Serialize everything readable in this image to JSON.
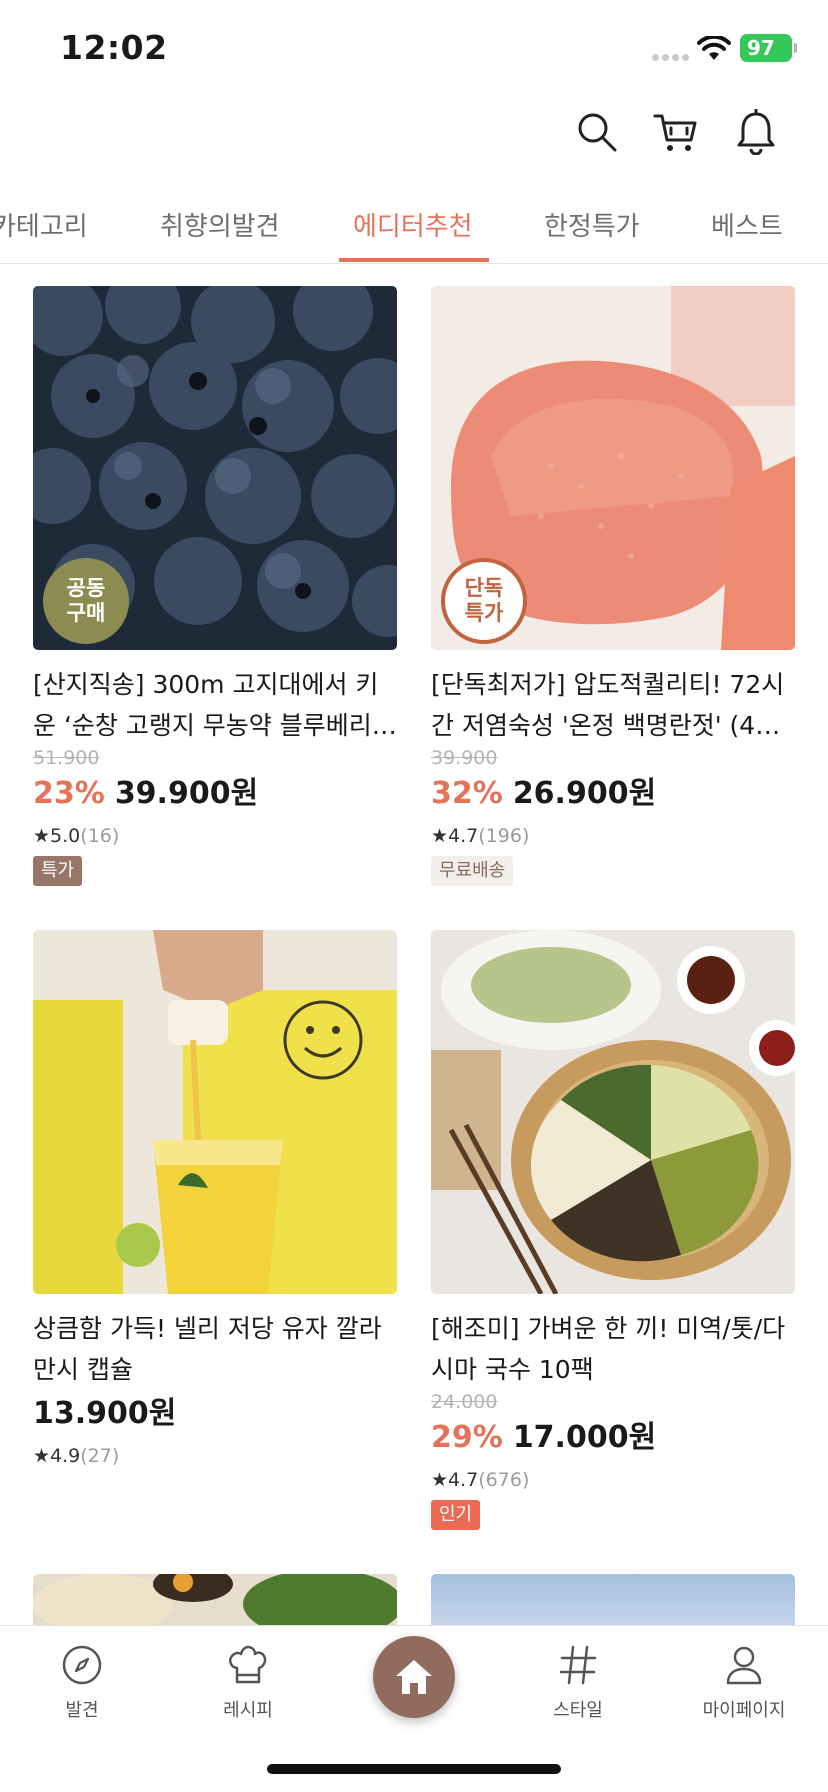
{
  "status_bar": {
    "time": "12:02",
    "battery": "97"
  },
  "header": {
    "icons": [
      "search-icon",
      "cart-icon",
      "bell-icon"
    ]
  },
  "tabs": [
    {
      "label": "카테고리"
    },
    {
      "label": "취향의발견"
    },
    {
      "label": "에디터추천",
      "active": true
    },
    {
      "label": "한정특가"
    },
    {
      "label": "베스트"
    }
  ],
  "products": [
    {
      "badge": [
        "공동",
        "구매"
      ],
      "title": "[산지직송] 300m 고지대에서 키운 ‘순창 고랭지 무농약 블루베리…",
      "original_price": "51.900",
      "discount": "23%",
      "price": "39.900원",
      "rating": "5.0",
      "review_count": "(16)",
      "tag": "특가"
    },
    {
      "badge": [
        "단독",
        "특가"
      ],
      "title": "[단독최저가] 압도적퀄리티! 72시간 저염숙성 '온정 백명란젓' (4…",
      "original_price": "39.900",
      "discount": "32%",
      "price": "26.900원",
      "rating": "4.7",
      "review_count": "(196)",
      "tag": "무료배송"
    },
    {
      "title": "상큼함 가득! 넬리 저당 유자 깔라만시 캡슐",
      "price": "13.900원",
      "rating": "4.9",
      "review_count": "(27)"
    },
    {
      "title": "[해조미] 가벼운 한 끼! 미역/톳/다시마 국수 10팩",
      "original_price": "24.000",
      "discount": "29%",
      "price": "17.000원",
      "rating": "4.7",
      "review_count": "(676)",
      "tag": "인기"
    }
  ],
  "bottom_nav": [
    {
      "label": "발견",
      "icon": "compass-icon"
    },
    {
      "label": "레시피",
      "icon": "chef-hat-icon"
    },
    {
      "label": "",
      "icon": "home-icon"
    },
    {
      "label": "스타일",
      "icon": "hash-icon"
    },
    {
      "label": "마이페이지",
      "icon": "person-icon"
    }
  ],
  "colors": {
    "accent": "#e4735a",
    "brand": "#926b5f"
  }
}
